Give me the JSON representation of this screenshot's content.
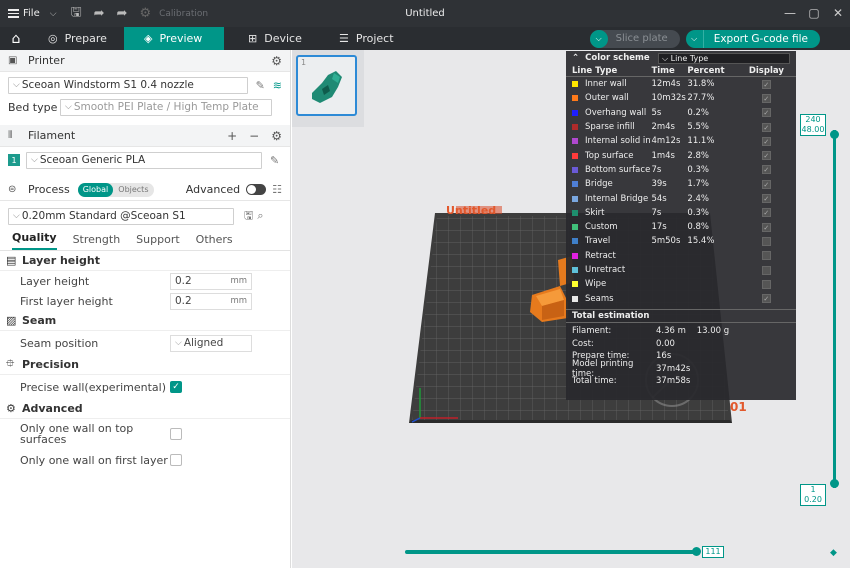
{
  "titlebar": {
    "file_label": "File",
    "calibration_label": "Calibration",
    "window_title": "Untitled",
    "minimize": "—",
    "maximize": "▢",
    "close": "✕"
  },
  "nav": {
    "tabs": [
      {
        "label": "Prepare",
        "icon": "prepare-icon",
        "active": false
      },
      {
        "label": "Preview",
        "icon": "preview-icon",
        "active": true
      },
      {
        "label": "Device",
        "icon": "device-icon",
        "active": false
      },
      {
        "label": "Project",
        "icon": "project-icon",
        "active": false
      }
    ],
    "slice_label": "Slice plate",
    "export_label": "Export G-code file"
  },
  "printer": {
    "section_title": "Printer",
    "name": "Sceoan Windstorm S1 0.4 nozzle",
    "bed_type_label": "Bed type",
    "bed_type_value": "Smooth PEI Plate / High Temp Plate"
  },
  "filament": {
    "section_title": "Filament",
    "slot_number": "1",
    "name": "Sceoan Generic PLA"
  },
  "process": {
    "section_title": "Process",
    "toggle_global": "Global",
    "toggle_objects": "Objects",
    "advanced_label": "Advanced",
    "profile": "0.20mm Standard @Sceoan S1",
    "tabs": [
      "Quality",
      "Strength",
      "Support",
      "Others"
    ],
    "groups": {
      "layer_height": "Layer height",
      "seam": "Seam",
      "precision": "Precision",
      "advanced": "Advanced"
    },
    "options": {
      "layer_height": {
        "label": "Layer height",
        "value": "0.2",
        "unit": "mm"
      },
      "first_layer_height": {
        "label": "First layer height",
        "value": "0.2",
        "unit": "mm"
      },
      "seam_position": {
        "label": "Seam position",
        "value": "Aligned"
      },
      "precise_wall": {
        "label": "Precise wall(experimental)",
        "checked": true
      },
      "one_wall_top": {
        "label": "Only one wall on top surfaces",
        "checked": false
      },
      "one_wall_first": {
        "label": "Only one wall on first layer",
        "checked": false
      }
    }
  },
  "viewport": {
    "plate_number": "1",
    "plate_label_text": "Untitled",
    "plate_suffix": "01",
    "vslider_top": "240",
    "vslider_top_h": "48.00",
    "vslider_bottom": "1",
    "vslider_bottom_h": "0.20",
    "hslider_value": "111"
  },
  "legend": {
    "title": "Color scheme",
    "scheme": "Line Type",
    "columns": [
      "Line Type",
      "Time",
      "Percent",
      "Display"
    ],
    "rows": [
      {
        "name": "Inner wall",
        "color": "#ffe600",
        "time": "12m4s",
        "percent": "31.8%",
        "display": true
      },
      {
        "name": "Outer wall",
        "color": "#ff7a1a",
        "time": "10m32s",
        "percent": "27.7%",
        "display": true
      },
      {
        "name": "Overhang wall",
        "color": "#1f1fff",
        "time": "5s",
        "percent": "0.2%",
        "display": true
      },
      {
        "name": "Sparse infill",
        "color": "#b02b2b",
        "time": "2m4s",
        "percent": "5.5%",
        "display": true
      },
      {
        "name": "Internal solid infill",
        "color": "#b048cf",
        "time": "4m12s",
        "percent": "11.1%",
        "display": true
      },
      {
        "name": "Top surface",
        "color": "#ff3b3b",
        "time": "1m4s",
        "percent": "2.8%",
        "display": true
      },
      {
        "name": "Bottom surface",
        "color": "#6a5ad6",
        "time": "7s",
        "percent": "0.3%",
        "display": true
      },
      {
        "name": "Bridge",
        "color": "#4f7fd6",
        "time": "39s",
        "percent": "1.7%",
        "display": true
      },
      {
        "name": "Internal Bridge",
        "color": "#7aa7e0",
        "time": "54s",
        "percent": "2.4%",
        "display": true
      },
      {
        "name": "Skirt",
        "color": "#1e8f6e",
        "time": "7s",
        "percent": "0.3%",
        "display": true
      },
      {
        "name": "Custom",
        "color": "#40c07a",
        "time": "17s",
        "percent": "0.8%",
        "display": true
      },
      {
        "name": "Travel",
        "color": "#3f7fc8",
        "time": "5m50s",
        "percent": "15.4%",
        "display": false
      },
      {
        "name": "Retract",
        "color": "#e020e0",
        "time": "",
        "percent": "",
        "display": false
      },
      {
        "name": "Unretract",
        "color": "#5fc0d8",
        "time": "",
        "percent": "",
        "display": false
      },
      {
        "name": "Wipe",
        "color": "#ffff30",
        "time": "",
        "percent": "",
        "display": false
      },
      {
        "name": "Seams",
        "color": "#e8e8e8",
        "time": "",
        "percent": "",
        "display": true
      }
    ],
    "total_title": "Total estimation",
    "estimates": [
      {
        "label": "Filament:",
        "value": "4.36 m    13.00 g"
      },
      {
        "label": "Cost:",
        "value": "0.00"
      },
      {
        "label": "Prepare time:",
        "value": "16s"
      },
      {
        "label": "Model printing time:",
        "value": "37m42s"
      },
      {
        "label": "Total time:",
        "value": "37m58s"
      }
    ]
  }
}
